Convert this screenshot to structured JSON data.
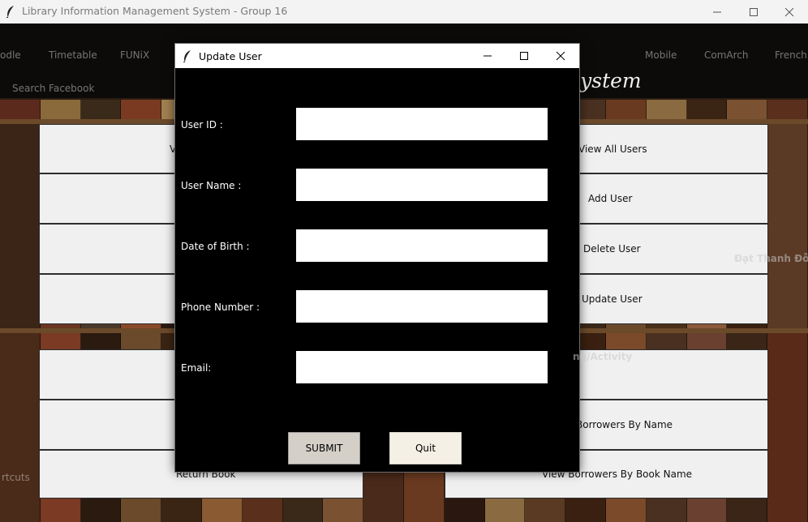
{
  "main_window": {
    "title": "Library Information Management System - Group 16",
    "heading_fragment": "System"
  },
  "background_ghost": {
    "items": [
      "odle",
      "Timetable",
      "FUNiX",
      "Mobile",
      "ComArch",
      "French",
      "Search Facebook",
      "rtcuts",
      "Đạt Thanh Đỗ",
      "ng/Activity"
    ]
  },
  "menu": {
    "left": [
      "V",
      "",
      "",
      "",
      "",
      "",
      "Return Book"
    ],
    "right": [
      "View All Users",
      "Add User",
      "Delete User",
      "Update User",
      "",
      "Borrowers By Name",
      "View Borrowers By Book Name"
    ]
  },
  "dialog": {
    "title": "Update User",
    "fields": [
      {
        "label": "User ID :",
        "value": ""
      },
      {
        "label": "User Name :",
        "value": ""
      },
      {
        "label": "Date of Birth :",
        "value": ""
      },
      {
        "label": "Phone Number :",
        "value": ""
      },
      {
        "label": "Email:",
        "value": ""
      }
    ],
    "submit_label": "SUBMIT",
    "quit_label": "Quit"
  },
  "colors": {
    "dialog_bg": "#000000",
    "submit_bg": "#d4d0c8",
    "quit_bg": "#f5f0e6",
    "menu_bg": "#f0f0f0"
  }
}
